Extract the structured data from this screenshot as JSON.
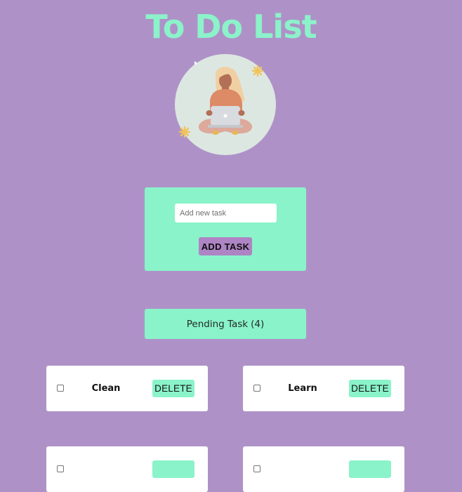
{
  "header": {
    "title": "To Do List"
  },
  "add_form": {
    "input_placeholder": "Add new task",
    "input_value": "",
    "button_label": "ADD TASK"
  },
  "pending": {
    "label": "Pending Task",
    "count": "(4)"
  },
  "tasks": [
    {
      "name": "Clean",
      "checked": false,
      "delete_label": "DELETE"
    },
    {
      "name": "Learn",
      "checked": false,
      "delete_label": "DELETE"
    },
    {
      "name": "",
      "checked": false,
      "delete_label": ""
    },
    {
      "name": "",
      "checked": false,
      "delete_label": ""
    }
  ],
  "colors": {
    "background": "#ae92c7",
    "accent": "#8af3ca",
    "button": "#ae84c4",
    "card": "#ffffff"
  },
  "icons": {
    "avatar": "woman-with-laptop-illustration",
    "checkbox": "checkbox-icon"
  }
}
